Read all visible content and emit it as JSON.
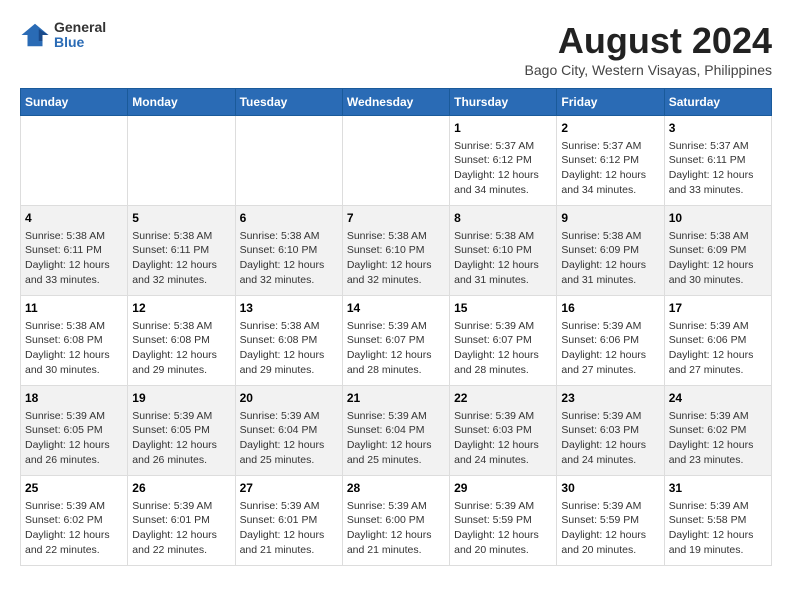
{
  "logo": {
    "general": "General",
    "blue": "Blue"
  },
  "title": "August 2024",
  "subtitle": "Bago City, Western Visayas, Philippines",
  "days_header": [
    "Sunday",
    "Monday",
    "Tuesday",
    "Wednesday",
    "Thursday",
    "Friday",
    "Saturday"
  ],
  "weeks": [
    [
      {
        "day": "",
        "info": ""
      },
      {
        "day": "",
        "info": ""
      },
      {
        "day": "",
        "info": ""
      },
      {
        "day": "",
        "info": ""
      },
      {
        "day": "1",
        "info": "Sunrise: 5:37 AM\nSunset: 6:12 PM\nDaylight: 12 hours\nand 34 minutes."
      },
      {
        "day": "2",
        "info": "Sunrise: 5:37 AM\nSunset: 6:12 PM\nDaylight: 12 hours\nand 34 minutes."
      },
      {
        "day": "3",
        "info": "Sunrise: 5:37 AM\nSunset: 6:11 PM\nDaylight: 12 hours\nand 33 minutes."
      }
    ],
    [
      {
        "day": "4",
        "info": "Sunrise: 5:38 AM\nSunset: 6:11 PM\nDaylight: 12 hours\nand 33 minutes."
      },
      {
        "day": "5",
        "info": "Sunrise: 5:38 AM\nSunset: 6:11 PM\nDaylight: 12 hours\nand 32 minutes."
      },
      {
        "day": "6",
        "info": "Sunrise: 5:38 AM\nSunset: 6:10 PM\nDaylight: 12 hours\nand 32 minutes."
      },
      {
        "day": "7",
        "info": "Sunrise: 5:38 AM\nSunset: 6:10 PM\nDaylight: 12 hours\nand 32 minutes."
      },
      {
        "day": "8",
        "info": "Sunrise: 5:38 AM\nSunset: 6:10 PM\nDaylight: 12 hours\nand 31 minutes."
      },
      {
        "day": "9",
        "info": "Sunrise: 5:38 AM\nSunset: 6:09 PM\nDaylight: 12 hours\nand 31 minutes."
      },
      {
        "day": "10",
        "info": "Sunrise: 5:38 AM\nSunset: 6:09 PM\nDaylight: 12 hours\nand 30 minutes."
      }
    ],
    [
      {
        "day": "11",
        "info": "Sunrise: 5:38 AM\nSunset: 6:08 PM\nDaylight: 12 hours\nand 30 minutes."
      },
      {
        "day": "12",
        "info": "Sunrise: 5:38 AM\nSunset: 6:08 PM\nDaylight: 12 hours\nand 29 minutes."
      },
      {
        "day": "13",
        "info": "Sunrise: 5:38 AM\nSunset: 6:08 PM\nDaylight: 12 hours\nand 29 minutes."
      },
      {
        "day": "14",
        "info": "Sunrise: 5:39 AM\nSunset: 6:07 PM\nDaylight: 12 hours\nand 28 minutes."
      },
      {
        "day": "15",
        "info": "Sunrise: 5:39 AM\nSunset: 6:07 PM\nDaylight: 12 hours\nand 28 minutes."
      },
      {
        "day": "16",
        "info": "Sunrise: 5:39 AM\nSunset: 6:06 PM\nDaylight: 12 hours\nand 27 minutes."
      },
      {
        "day": "17",
        "info": "Sunrise: 5:39 AM\nSunset: 6:06 PM\nDaylight: 12 hours\nand 27 minutes."
      }
    ],
    [
      {
        "day": "18",
        "info": "Sunrise: 5:39 AM\nSunset: 6:05 PM\nDaylight: 12 hours\nand 26 minutes."
      },
      {
        "day": "19",
        "info": "Sunrise: 5:39 AM\nSunset: 6:05 PM\nDaylight: 12 hours\nand 26 minutes."
      },
      {
        "day": "20",
        "info": "Sunrise: 5:39 AM\nSunset: 6:04 PM\nDaylight: 12 hours\nand 25 minutes."
      },
      {
        "day": "21",
        "info": "Sunrise: 5:39 AM\nSunset: 6:04 PM\nDaylight: 12 hours\nand 25 minutes."
      },
      {
        "day": "22",
        "info": "Sunrise: 5:39 AM\nSunset: 6:03 PM\nDaylight: 12 hours\nand 24 minutes."
      },
      {
        "day": "23",
        "info": "Sunrise: 5:39 AM\nSunset: 6:03 PM\nDaylight: 12 hours\nand 24 minutes."
      },
      {
        "day": "24",
        "info": "Sunrise: 5:39 AM\nSunset: 6:02 PM\nDaylight: 12 hours\nand 23 minutes."
      }
    ],
    [
      {
        "day": "25",
        "info": "Sunrise: 5:39 AM\nSunset: 6:02 PM\nDaylight: 12 hours\nand 22 minutes."
      },
      {
        "day": "26",
        "info": "Sunrise: 5:39 AM\nSunset: 6:01 PM\nDaylight: 12 hours\nand 22 minutes."
      },
      {
        "day": "27",
        "info": "Sunrise: 5:39 AM\nSunset: 6:01 PM\nDaylight: 12 hours\nand 21 minutes."
      },
      {
        "day": "28",
        "info": "Sunrise: 5:39 AM\nSunset: 6:00 PM\nDaylight: 12 hours\nand 21 minutes."
      },
      {
        "day": "29",
        "info": "Sunrise: 5:39 AM\nSunset: 5:59 PM\nDaylight: 12 hours\nand 20 minutes."
      },
      {
        "day": "30",
        "info": "Sunrise: 5:39 AM\nSunset: 5:59 PM\nDaylight: 12 hours\nand 20 minutes."
      },
      {
        "day": "31",
        "info": "Sunrise: 5:39 AM\nSunset: 5:58 PM\nDaylight: 12 hours\nand 19 minutes."
      }
    ]
  ]
}
